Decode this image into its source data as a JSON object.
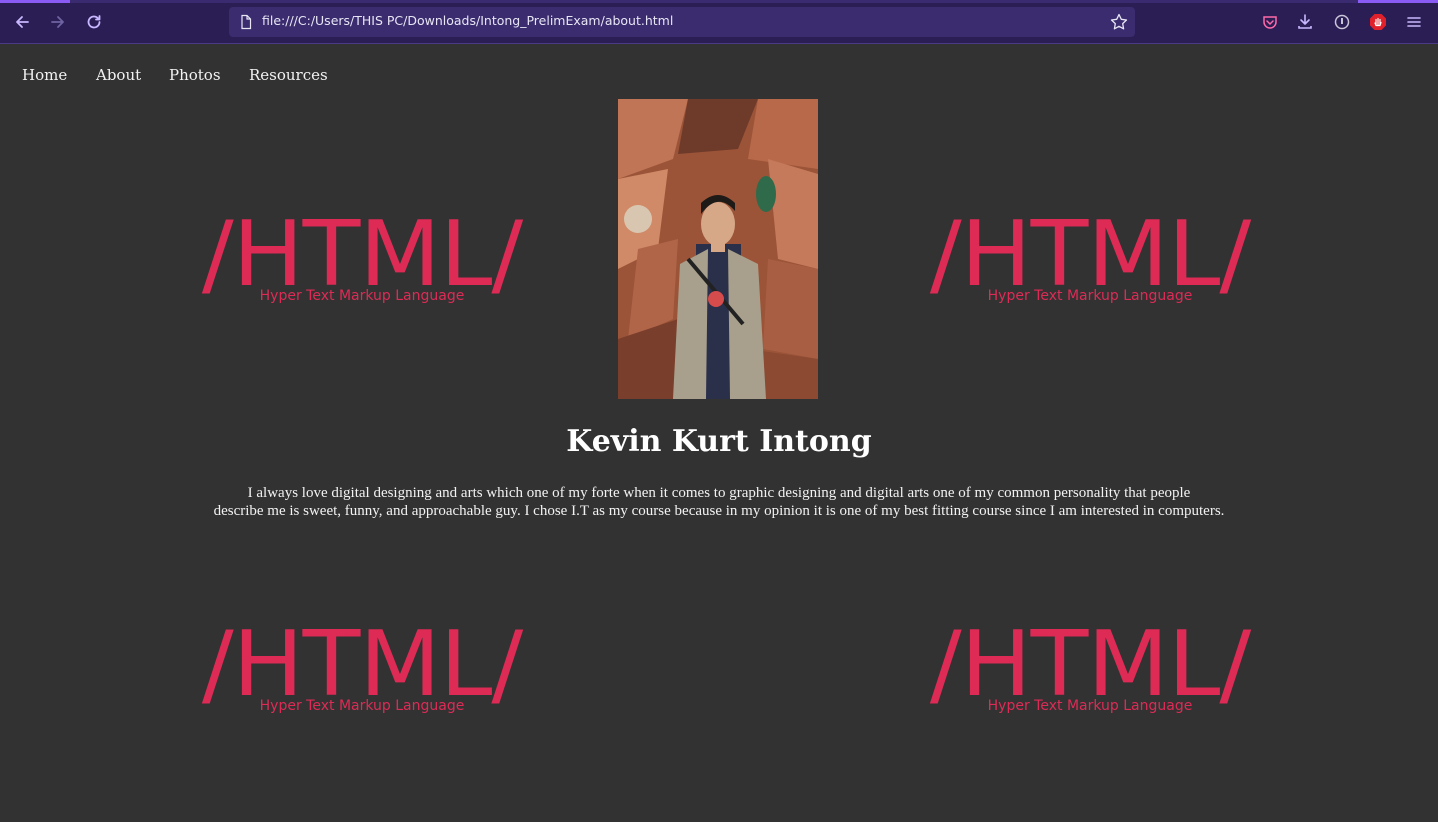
{
  "browser": {
    "url": "file:///C:/Users/THIS PC/Downloads/Intong_PrelimExam/about.html",
    "accent_color": "#2b1e55"
  },
  "nav": {
    "items": [
      {
        "label": "Home"
      },
      {
        "label": "About"
      },
      {
        "label": "Photos"
      },
      {
        "label": "Resources"
      }
    ]
  },
  "logo": {
    "main": "/HTML/",
    "sub": "Hyper Text Markup Language",
    "color": "#dd2b56"
  },
  "profile": {
    "name": "Kevin Kurt Intong",
    "bio_line1": "I always love digital designing and arts which one of my forte when it comes to graphic designing and digital arts one of my common personality that people",
    "bio_line2": "describe me is sweet, funny, and approachable guy. I chose I.T as my course because in my opinion it is one of my best fitting course since I am interested in computers."
  },
  "icons": {
    "back": "arrow-left-icon",
    "forward": "arrow-right-icon",
    "reload": "reload-icon",
    "page": "page-icon",
    "bookmark": "star-icon",
    "pocket": "pocket-icon",
    "downloads": "download-icon",
    "extension": "extension-icon",
    "adblock": "stop-hand-icon",
    "menu": "hamburger-menu-icon"
  }
}
